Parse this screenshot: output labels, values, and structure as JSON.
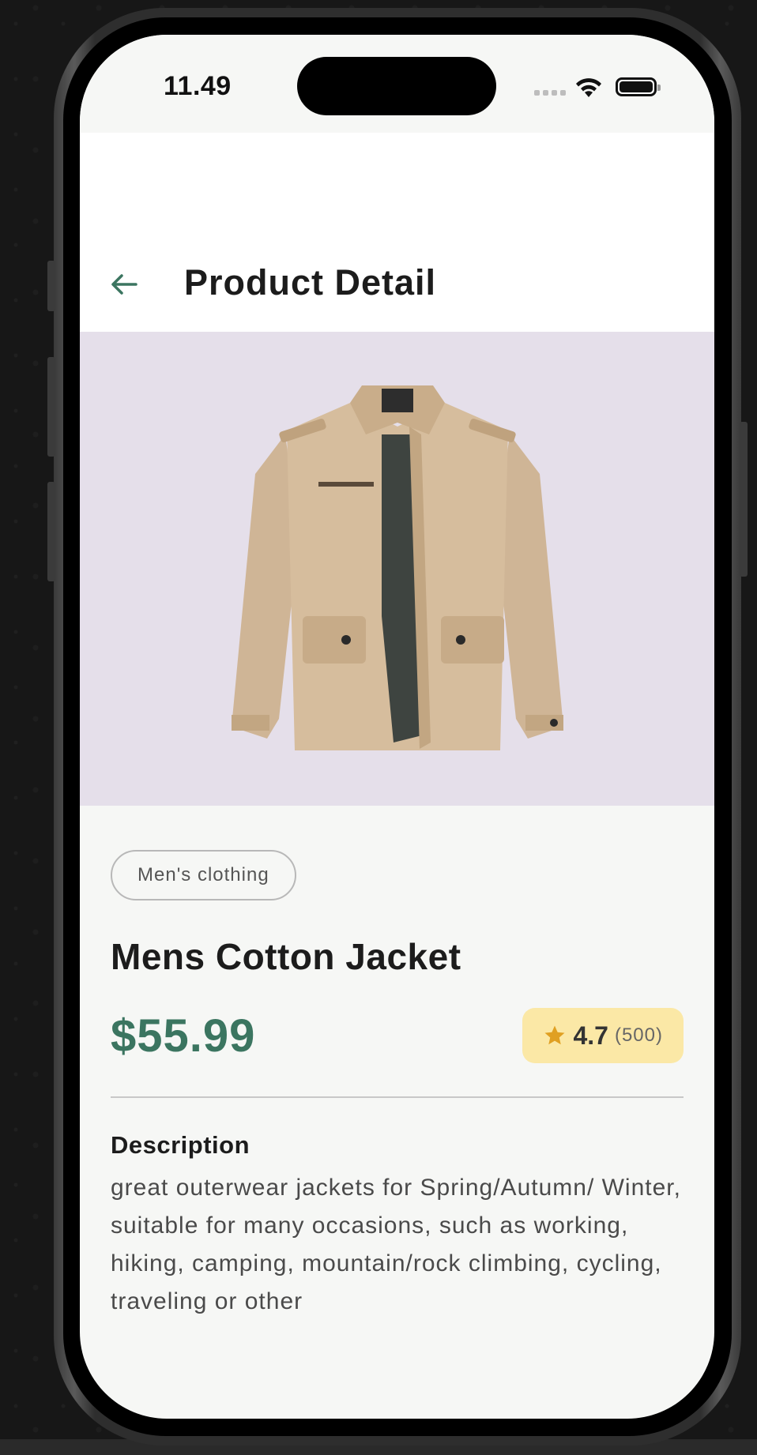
{
  "status_bar": {
    "time": "11.49"
  },
  "header": {
    "title": "Product Detail",
    "back_icon": "arrow-left-icon"
  },
  "product": {
    "image_alt": "jacket",
    "category": "Men's clothing",
    "name": "Mens Cotton Jacket",
    "price": "$55.99",
    "rating": {
      "value": "4.7",
      "count": "(500)",
      "icon": "star-icon"
    },
    "description_heading": "Description",
    "description": "great outerwear jackets for Spring/Autumn/ Winter, suitable for many occasions, such as working, hiking, camping, mountain/rock climbing, cycling, traveling or other"
  },
  "colors": {
    "accent_green": "#3b7560",
    "image_background": "#e5dfea",
    "rating_badge": "#fbe8a6",
    "star": "#e0a022"
  }
}
